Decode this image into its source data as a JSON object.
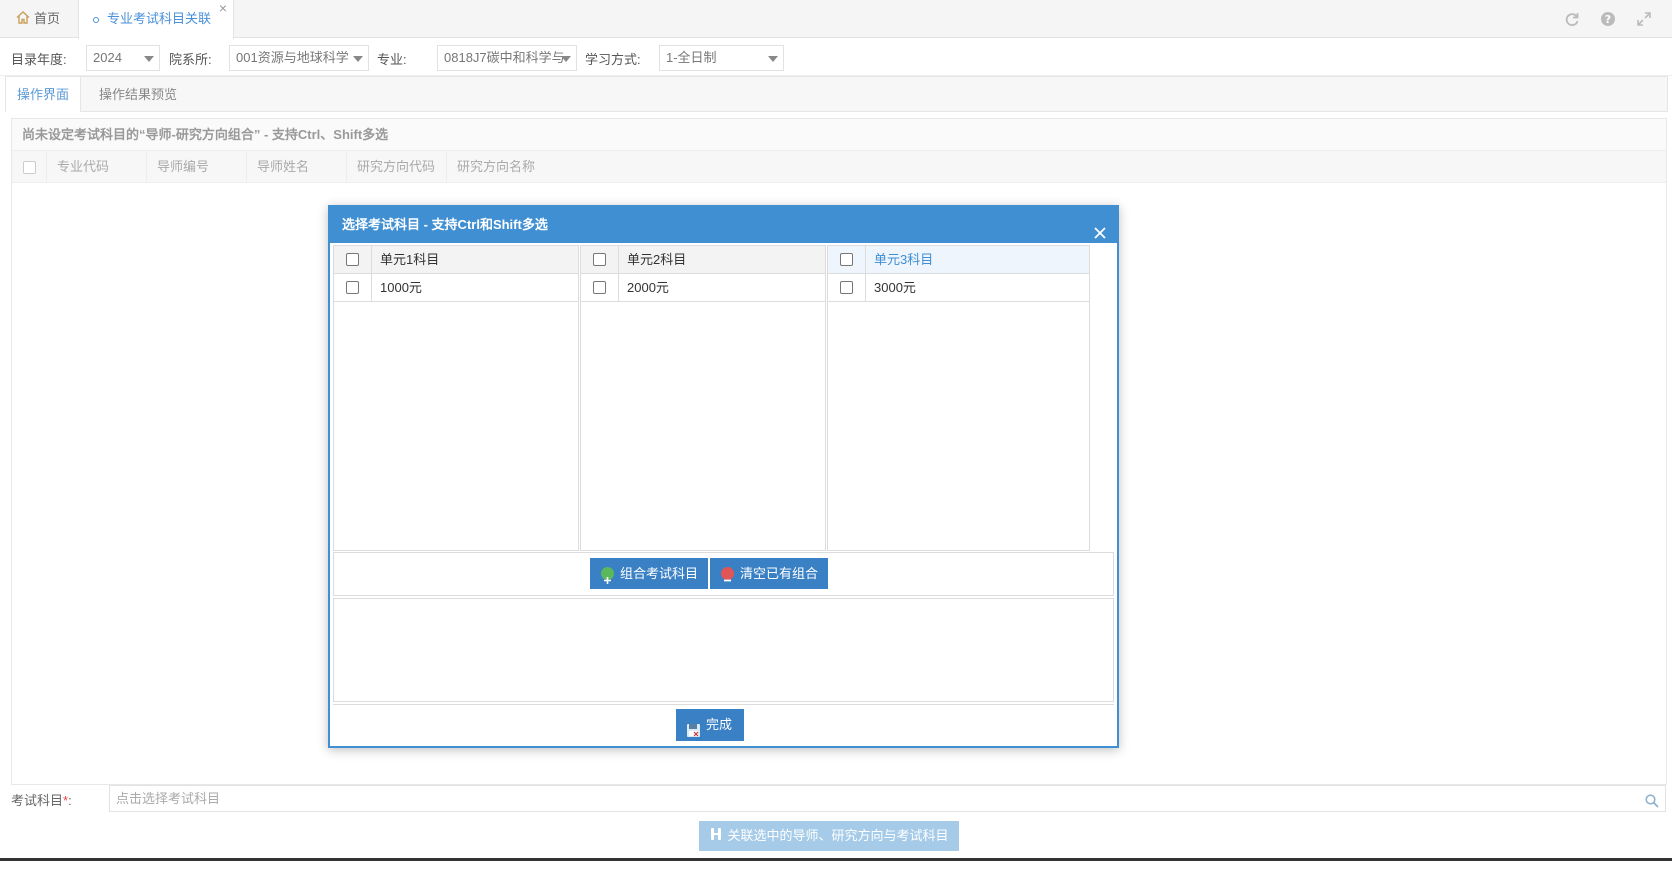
{
  "tabs": {
    "home": "首页",
    "active": "专业考试科目关联",
    "close": "×"
  },
  "filters": {
    "year_label": "目录年度:",
    "year_value": "2024",
    "dept_label": "院系所:",
    "dept_value": "001资源与地球科学",
    "major_label": "专业:",
    "major_value": "0818J7碳中和科学与",
    "mode_label": "学习方式:",
    "mode_value": "1-全日制"
  },
  "subtabs": {
    "operate": "操作界面",
    "preview": "操作结果预览"
  },
  "panel": {
    "title": "尚未设定考试科目的“导师-研究方向组合” - 支持Ctrl、Shift多选",
    "columns": [
      "专业代码",
      "导师编号",
      "导师姓名",
      "研究方向代码",
      "研究方向名称"
    ]
  },
  "bottom": {
    "exam_label": "考试科目",
    "required_mark": "*",
    "colon": ":",
    "exam_placeholder": "点击选择考试科目",
    "link_button": "关联选中的导师、研究方向与考试科目"
  },
  "modal": {
    "title": "选择考试科目 - 支持Ctrl和Shift多选",
    "columns": [
      {
        "header": "单元1科目",
        "items": [
          "1000元"
        ]
      },
      {
        "header": "单元2科目",
        "items": [
          "2000元"
        ]
      },
      {
        "header": "单元3科目",
        "items": [
          "3000元"
        ]
      }
    ],
    "combine_button": "组合考试科目",
    "clear_button": "清空已有组合",
    "done_button": "完成"
  },
  "colors": {
    "accent": "#3f8fd2",
    "tab_active_text": "#4a90d9",
    "link_button_bg": "#a6cbe8"
  }
}
